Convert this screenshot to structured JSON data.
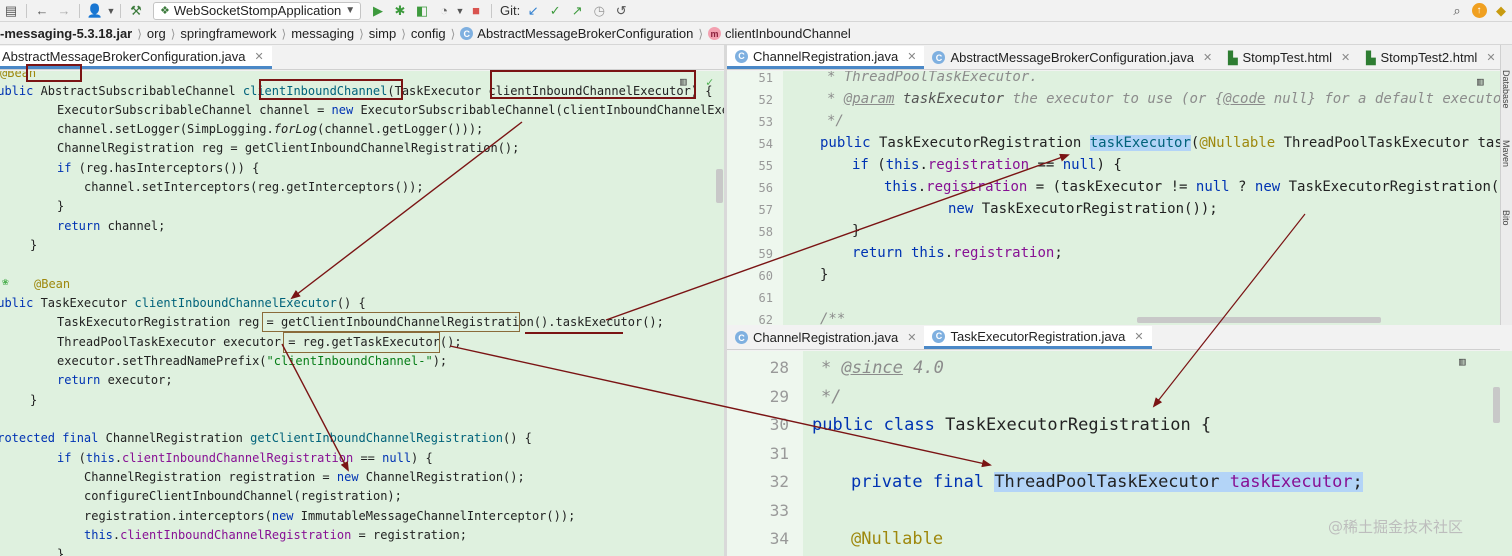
{
  "toolbar": {
    "run_config": "WebSocketStompApplication",
    "git_label": "Git:"
  },
  "breadcrumb": {
    "jar": "-messaging-5.3.18.jar",
    "items": [
      "org",
      "springframework",
      "messaging",
      "simp",
      "config"
    ],
    "class_name": "AbstractMessageBrokerConfiguration",
    "method_name": "clientInboundChannel"
  },
  "left_tab": "AbstractMessageBrokerConfiguration.java",
  "right_top_tabs": [
    "ChannelRegistration.java",
    "AbstractMessageBrokerConfiguration.java",
    "StompTest.html",
    "StompTest2.html"
  ],
  "right_bottom_tabs": [
    "ChannelRegistration.java",
    "TaskExecutorRegistration.java"
  ],
  "side_labels": [
    "Database",
    "Maven",
    "Bito"
  ],
  "right_top_line_numbers": [
    "51",
    "52",
    "53",
    "54",
    "55",
    "56",
    "57",
    "58",
    "59",
    "60",
    "61",
    "62"
  ],
  "right_bottom_line_numbers": [
    "28",
    "29",
    "30",
    "31",
    "32",
    "33",
    "34"
  ],
  "watermark": "@稀土掘金技术社区",
  "colors": {
    "editor_bg": "#dff1df",
    "highlight": "#b3d4f7",
    "annotation_red": "#7a1414",
    "tab_active": "#4a88c7"
  }
}
